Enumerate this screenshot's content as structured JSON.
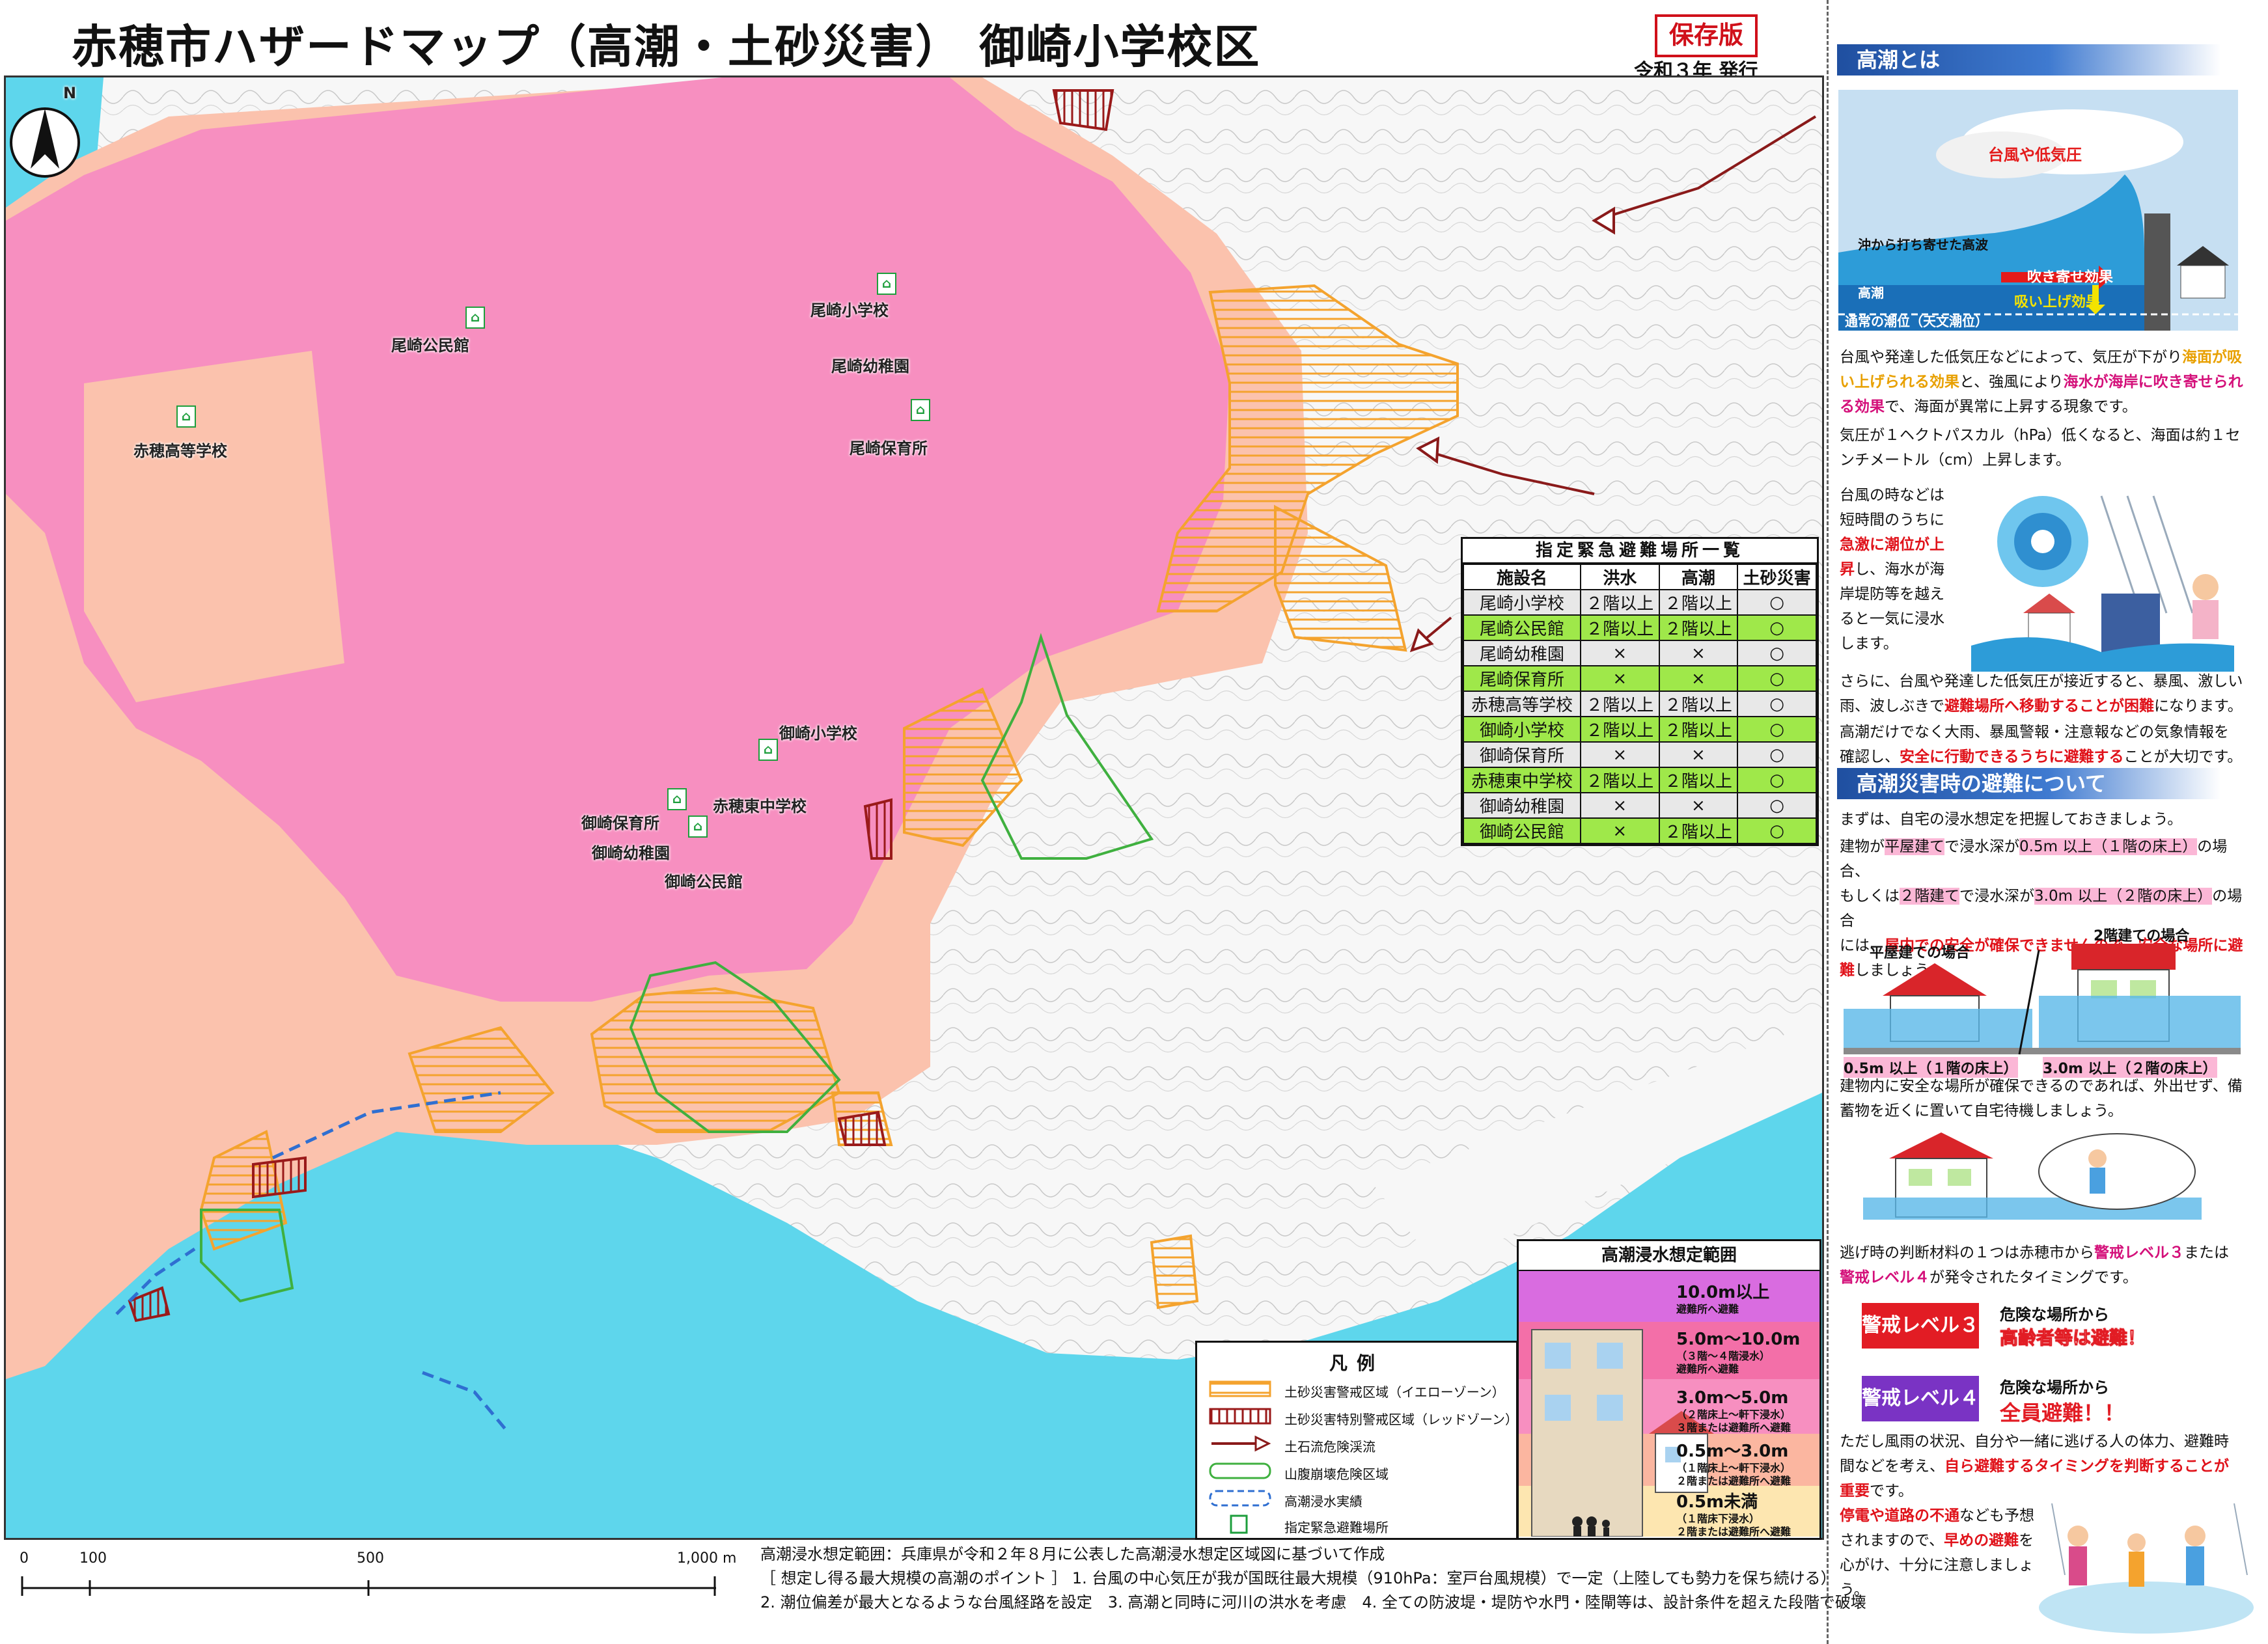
{
  "header": {
    "title": "赤穂市ハザードマップ（高潮・土砂災害） 御崎小学校区",
    "edition_badge": "保存版",
    "issued": "令和３年 発行"
  },
  "map": {
    "facilities": [
      {
        "name": "尾崎小学校",
        "shelter": true
      },
      {
        "name": "尾崎公民館",
        "shelter": true
      },
      {
        "name": "尾崎幼稚園",
        "shelter": true
      },
      {
        "name": "尾崎保育所",
        "shelter": true
      },
      {
        "name": "赤穂高等学校",
        "shelter": true
      },
      {
        "name": "御崎小学校",
        "shelter": true
      },
      {
        "name": "赤穂東中学校",
        "shelter": true
      },
      {
        "name": "御崎保育所",
        "shelter": true
      },
      {
        "name": "御崎幼稚園",
        "shelter": true
      },
      {
        "name": "御崎公民館",
        "shelter": true
      }
    ],
    "shelter_icon_glyph": "⌂",
    "north_label": "N",
    "colors": {
      "inundation_pink": "#f78fc0",
      "inundation_salmon": "#fbc2ad",
      "sea": "#5ed6ec",
      "yellow_zone": "#f4a32e",
      "red_zone": "#9a1a1a",
      "landslide_zone": "#3fb03f",
      "past_inundation": "#2f6fd1"
    }
  },
  "evac_table": {
    "title": "指定緊急避難場所一覧",
    "columns": [
      "施設名",
      "洪水",
      "高潮",
      "土砂災害"
    ],
    "rows": [
      [
        "尾崎小学校",
        "２階以上",
        "２階以上",
        "○"
      ],
      [
        "尾崎公民館",
        "２階以上",
        "２階以上",
        "○"
      ],
      [
        "尾崎幼稚園",
        "×",
        "×",
        "○"
      ],
      [
        "尾崎保育所",
        "×",
        "×",
        "○"
      ],
      [
        "赤穂高等学校",
        "２階以上",
        "２階以上",
        "○"
      ],
      [
        "御崎小学校",
        "２階以上",
        "２階以上",
        "○"
      ],
      [
        "御崎保育所",
        "×",
        "×",
        "○"
      ],
      [
        "赤穂東中学校",
        "２階以上",
        "２階以上",
        "○"
      ],
      [
        "御崎幼稚園",
        "×",
        "×",
        "○"
      ],
      [
        "御崎公民館",
        "×",
        "２階以上",
        "○"
      ]
    ]
  },
  "legend": {
    "title": "凡例",
    "items": [
      {
        "label": "土砂災害警戒区域（イエローゾーン）"
      },
      {
        "label": "土砂災害特別警戒区域（レッドゾーン）"
      },
      {
        "label": "土石流危険渓流"
      },
      {
        "label": "山腹崩壊危険区域"
      },
      {
        "label": "高潮浸水実績"
      },
      {
        "label": "指定緊急避難場所"
      }
    ]
  },
  "inundation_legend": {
    "title": "高潮浸水想定範囲",
    "bands": [
      {
        "depth": "10.0m以上",
        "note": "避難所へ避難",
        "color": "#d96ce0"
      },
      {
        "depth": "5.0m～10.0m",
        "note": "（３階～４階浸水）\n避難所へ避難",
        "color": "#f36fa8"
      },
      {
        "depth": "3.0m～5.0m",
        "note": "（２階床上～軒下浸水）\n３階または避難所へ避難",
        "color": "#f78fc0"
      },
      {
        "depth": "0.5m～3.0m",
        "note": "（１階床上～軒下浸水）\n２階または避難所へ避難",
        "color": "#fbb6a0"
      },
      {
        "depth": "0.5m未満",
        "note": "（１階床下浸水）\n２階または避難所へ避難",
        "color": "#fde6b0"
      }
    ]
  },
  "scale": {
    "ticks": [
      "0",
      "100",
      "500",
      "1,000 m"
    ]
  },
  "notes": {
    "line1": "高潮浸水想定範囲：兵庫県が令和２年８月に公表した高潮浸水想定区域図に基づいて作成",
    "line2": "［ 想定し得る最大規模の高潮のポイント ］ 1. 台風の中心気圧が我が国既往最大規模（910hPa：室戸台風規模）で一定（上陸しても勢力を保ち続ける）",
    "line3": "2. 潮位偏差が最大となるような台風経路を設定　3. 高潮と同時に河川の洪水を考慮　4. 全ての防波堤・堤防や水門・陸閘等は、設計条件を超えた段階で破壊"
  },
  "side": {
    "sec1_title": "高潮とは",
    "diagram1": {
      "typhoon": "台風や低気圧",
      "waves": "沖から打ち寄せた高波",
      "high_tide": "高潮",
      "wind": "吹き寄せ効果",
      "suction": "吸い上げ効果",
      "normal": "通常の潮位（天文潮位）"
    },
    "p1a": "台風や発達した低気圧などによって、気圧が下がり",
    "p1b": "海面が吸い上げられる効果",
    "p1c": "と、強風により",
    "p1d": "海水が海岸に吹き寄せられる効果",
    "p1e": "で、海面が異常に上昇する現象です。",
    "p2": "気圧が１ヘクトパスカル（hPa）低くなると、海面は約１センチメートル（cm）上昇します。",
    "p3a": "台風の時などは短時間のうちに",
    "p3b": "急激に潮位が上昇",
    "p3c": "し、海水が海岸堤防等を越えると一気に浸水します。",
    "p4a": "さらに、台風や発達した低気圧が接近すると、暴風、激しい雨、波しぶきで",
    "p4b": "避難場所へ移動することが困難",
    "p4c": "になります。",
    "p5a": "高潮だけでなく大雨、暴風警報・注意報などの気象情報を確認し、",
    "p5b": "安全に行動できるうちに避難する",
    "p5c": "ことが大切です。",
    "sec2_title": "高潮災害時の避難について",
    "q1": "まずは、自宅の浸水想定を把握しておきましょう。",
    "q2a": "建物が",
    "q2b": "平屋建て",
    "q2c": "で浸水深が",
    "q2d": "0.5m 以上（１階の床上）",
    "q2e": "の場合、",
    "q3a": "もしくは",
    "q3b": "２階建て",
    "q3c": "で浸水深が",
    "q3d": "3.0m 以上（２階の床上）",
    "q3e": "の場合",
    "q4a": "には、",
    "q4b": "屋内での安全が確保できませんので、安全な場所に避難",
    "q4c": "しましょう。",
    "house1": "平屋建ての場合",
    "house2": "2階建ての場合",
    "depth1": "0.5m 以上（１階の床上）",
    "depth2": "3.0m 以上（２階の床上）",
    "q5": "建物内に安全な場所が確保できるのであれば、外出せず、備蓄物を近くに置いて自宅待機しましょう。",
    "q6a": "逃げ時の判断材料の１つは赤穂市から",
    "q6b": "警戒レベル３",
    "q6c": "または",
    "q6d": "警戒レベル４",
    "q6e": "が発令されたタイミングです。",
    "lvl3": "警戒レベル３",
    "lvl3_t1": "危険な場所から",
    "lvl3_t2": "高齢者等は避難！",
    "lvl4": "警戒レベル４",
    "lvl4_t1": "危険な場所から",
    "lvl4_t2": "全員避難！！",
    "q7a": "ただし風雨の状況、自分や一緒に逃げる人の体力、避難時間などを考え、",
    "q7b": "自ら避難するタイミングを判断することが重要",
    "q7c": "です。",
    "q8a": "停電や道路の不通",
    "q8b": "なども予想されますので、",
    "q8c": "早めの避難",
    "q8d": "を心がけ、十分に注意しましょう。"
  }
}
